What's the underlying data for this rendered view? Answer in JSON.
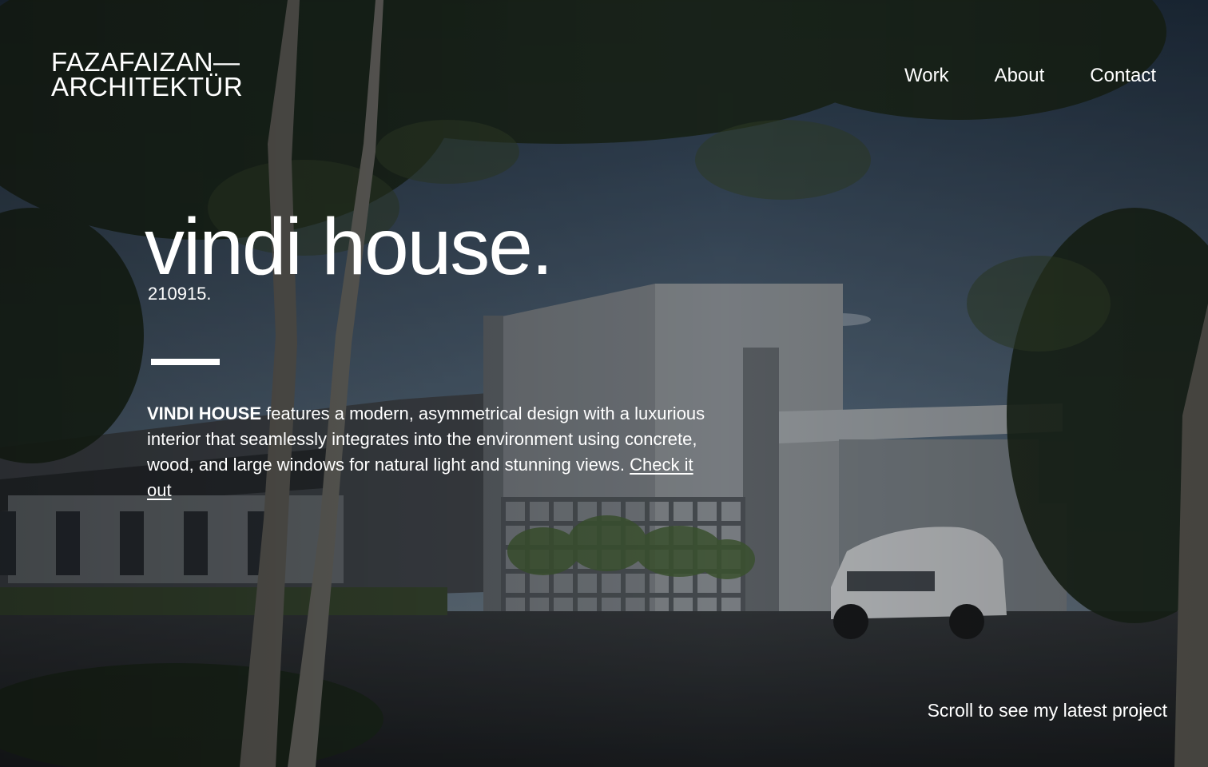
{
  "site": {
    "logo_line1": "FAZAFAIZAN—",
    "logo_line2": "ARCHITEKTÜR"
  },
  "nav": {
    "items": [
      {
        "label": "Work"
      },
      {
        "label": "About"
      },
      {
        "label": "Contact"
      }
    ]
  },
  "hero": {
    "title": "vindi house.",
    "code": "210915.",
    "description": {
      "highlight": "VINDI HOUSE",
      "body": " features a modern, asymmetrical design with a luxurious interior that seamlessly integrates into the environment using concrete, wood, and large windows for natural light and stunning views. ",
      "link_label": "Check it out"
    },
    "scroll_hint": "Scroll to see my latest project"
  },
  "colors": {
    "text": "#ffffff",
    "sky_top": "#2b3d52",
    "sky_bottom": "#7f93a6",
    "concrete": "#8a8f93",
    "ground": "#2c2f33",
    "foliage": "#1e2a1a"
  }
}
